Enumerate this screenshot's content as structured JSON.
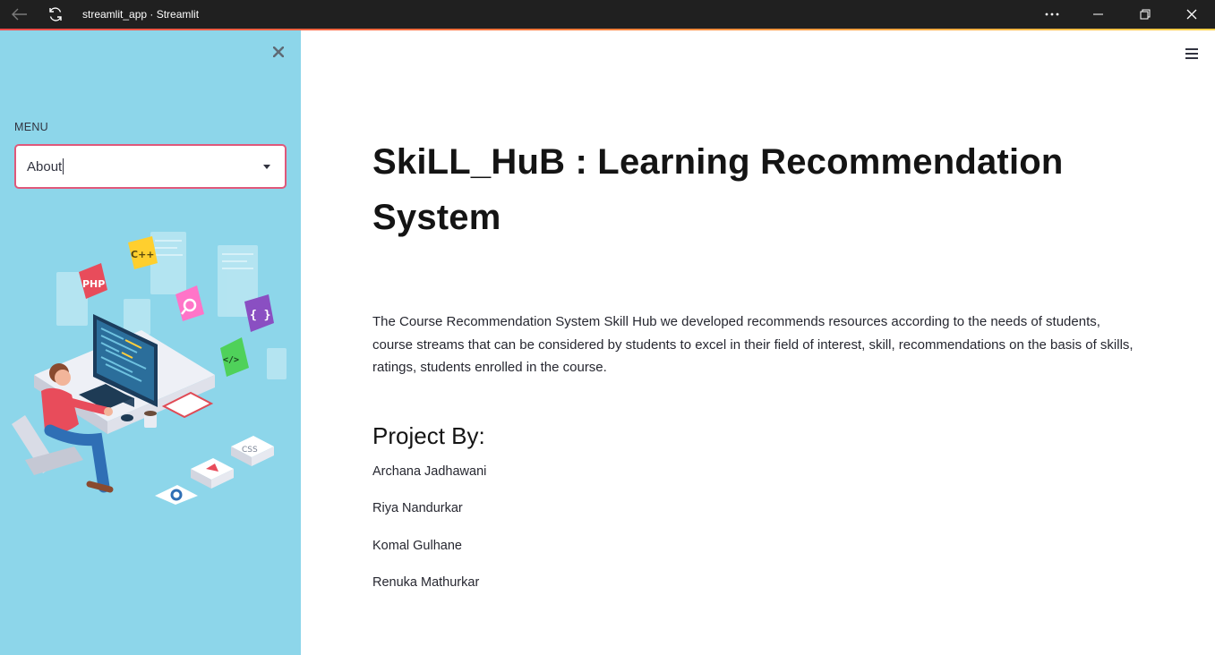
{
  "window": {
    "title": "streamlit_app · Streamlit",
    "back_icon": "back-arrow-icon",
    "reload_icon": "reload-icon",
    "more_icon": "more-options-icon",
    "minimize_icon": "minimize-icon",
    "restore_icon": "restore-icon",
    "close_icon": "close-icon"
  },
  "colors": {
    "sidebar_bg": "#8dd6ea",
    "accent": "#ff4b4b",
    "select_border": "#e0587a"
  },
  "sidebar": {
    "close_icon": "close-icon",
    "menu_label": "MENU",
    "select": {
      "value": "About",
      "arrow_icon": "dropdown-arrow-icon"
    },
    "illustration": {
      "description_icon": "developer-illustration",
      "badges": {
        "php": "PHP",
        "cpp": "C++",
        "braces": "{ }",
        "code": "</>",
        "css": "CSS"
      }
    }
  },
  "main": {
    "menu_icon": "hamburger-menu-icon",
    "title": "SkiLL_HuB : Learning Recommendation System",
    "description": "The Course Recommendation System Skill Hub we developed recommends resources according to the needs of students, course streams that can be considered by students to excel in their field of interest, skill, recommendations on the basis of skills, ratings, students enrolled in the course.",
    "project_by": {
      "heading": "Project By:",
      "members": [
        "Archana Jadhawani",
        "Riya Nandurkar",
        "Komal Gulhane",
        "Renuka Mathurkar"
      ]
    }
  }
}
